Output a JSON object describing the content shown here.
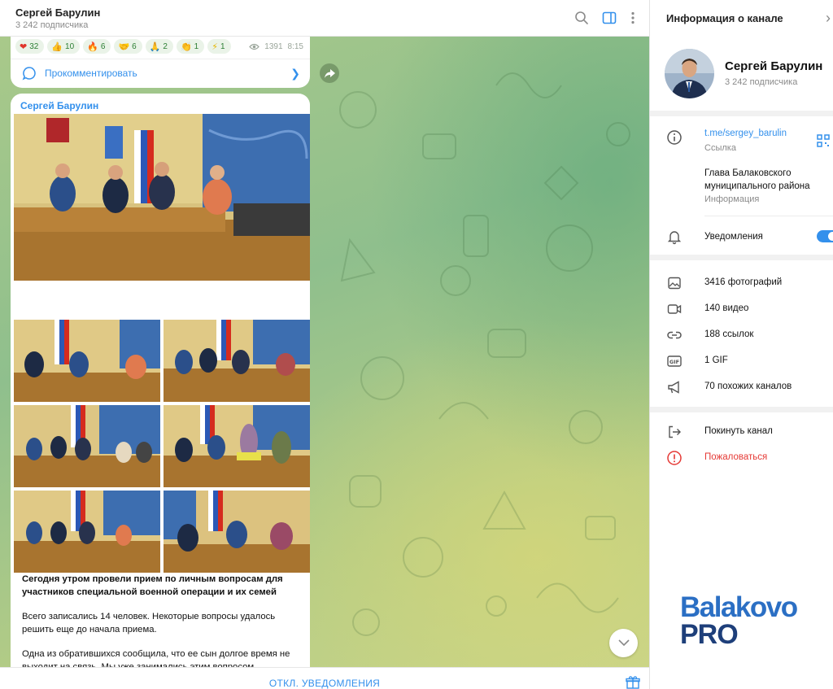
{
  "chat": {
    "title": "Сергей Барулин",
    "subscribers": "3 242 подписчика",
    "icons": [
      "search-icon",
      "side-panel-icon",
      "more-icon"
    ],
    "prev_post": {
      "reactions": [
        {
          "emoji": "❤",
          "count": "32"
        },
        {
          "emoji": "👍",
          "count": "10"
        },
        {
          "emoji": "🔥",
          "count": "6"
        },
        {
          "emoji": "🤝",
          "count": "6"
        },
        {
          "emoji": "🙏",
          "count": "2"
        },
        {
          "emoji": "👏",
          "count": "1"
        },
        {
          "emoji": "⚡",
          "count": "1"
        }
      ],
      "views": "1391",
      "time": "8:15",
      "comment_label": "Прокомментировать"
    },
    "post": {
      "author": "Сергей Барулин",
      "text_bold": "Сегодня утром провели прием по личным вопросам для участников специальной военной операции и их семей",
      "paragraph_1": "Всего записались 14 человек. Некоторые вопросы удалось решить еще до начала приема.",
      "paragraph_2": "Одна из обратившихся сообщила, что ее сын долгое время не выходит на связь. Мы уже занимались этим вопросом. Командир части подтвердил, что с военнослужащим всё в порядке. Он служит в зоне специальной военной операции."
    },
    "footer": {
      "mute_label": "ОТКЛ. УВЕДОМЛЕНИЯ"
    }
  },
  "info_panel": {
    "header": "Информация о канале",
    "name": "Сергей Барулин",
    "subscribers": "3 242 подписчика",
    "link": "t.me/sergey_barulin",
    "link_caption": "Ссылка",
    "about": "Глава Балаковского муниципального района",
    "about_caption": "Информация",
    "notifications_label": "Уведомления",
    "notifications_on": true,
    "media": {
      "photos": "3416 фотографий",
      "videos": "140 видео",
      "links": "188 ссылок",
      "gifs": "1 GIF",
      "similar": "70 похожих каналов"
    },
    "leave": "Покинуть канал",
    "report": "Пожаловаться",
    "accent_color": "#3390ec",
    "danger_color": "#e53935"
  },
  "watermark": {
    "line1": "Balakovo",
    "line2": "PRO"
  }
}
